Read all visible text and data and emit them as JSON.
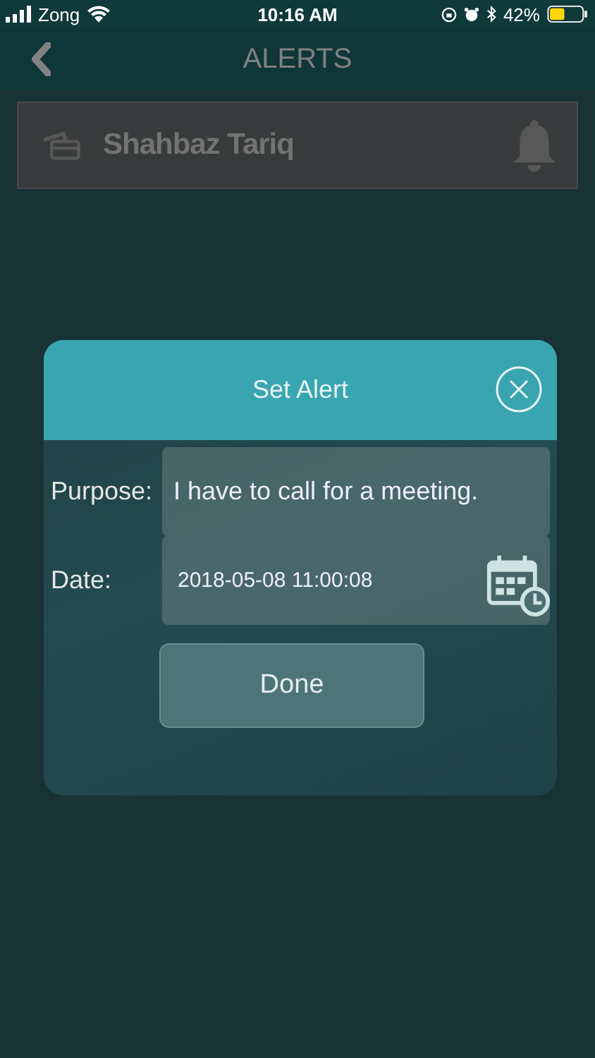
{
  "status_bar": {
    "carrier": "Zong",
    "time": "10:16 AM",
    "battery": "42%"
  },
  "header": {
    "title": "ALERTS"
  },
  "alerts": [
    {
      "name": "Shahbaz Tariq"
    }
  ],
  "dialog": {
    "title": "Set Alert",
    "fields": [
      {
        "kind": "text",
        "label": "Purpose:",
        "value": "I have to call for a meeting."
      },
      {
        "kind": "date",
        "label": "Date:",
        "value": "2018-05-08 11:00:08"
      }
    ],
    "button": "Done"
  }
}
